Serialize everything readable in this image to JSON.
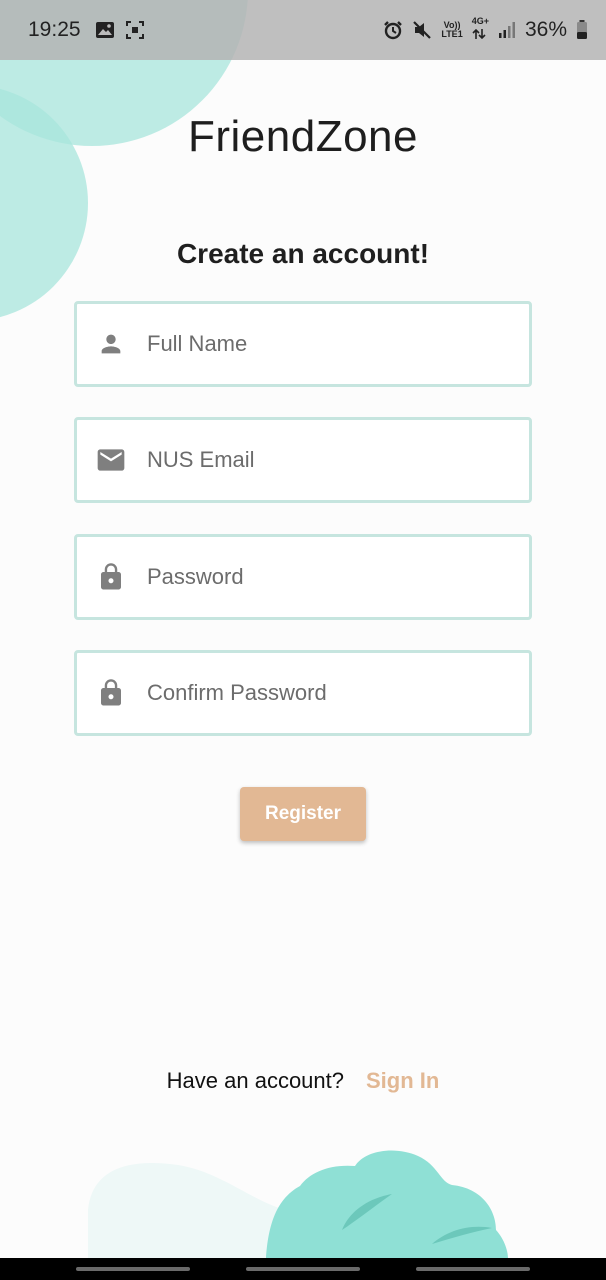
{
  "status_bar": {
    "time": "19:25",
    "volte_line1": "Vo))",
    "volte_line2": "LTE1",
    "network_type": "4G+",
    "battery_percent": "36%",
    "icons": [
      "gallery-icon",
      "screen-capture-icon",
      "alarm-icon",
      "mute-icon",
      "signal-icon",
      "battery-icon"
    ]
  },
  "app": {
    "title": "FriendZone"
  },
  "form": {
    "heading": "Create an account!",
    "fields": [
      {
        "placeholder": "Full Name",
        "icon": "person-icon",
        "value": ""
      },
      {
        "placeholder": "NUS Email",
        "icon": "mail-icon",
        "value": ""
      },
      {
        "placeholder": "Password",
        "icon": "lock-icon",
        "value": ""
      },
      {
        "placeholder": "Confirm Password",
        "icon": "lock-icon",
        "value": ""
      }
    ],
    "register_label": "Register"
  },
  "footer": {
    "prompt": "Have an account?",
    "sign_in_label": "Sign In"
  },
  "colors": {
    "accent": "#e2b894",
    "field_border": "#c6e5df",
    "blob_teal": "#9fe1d7",
    "blob_light": "#eef8f7"
  }
}
